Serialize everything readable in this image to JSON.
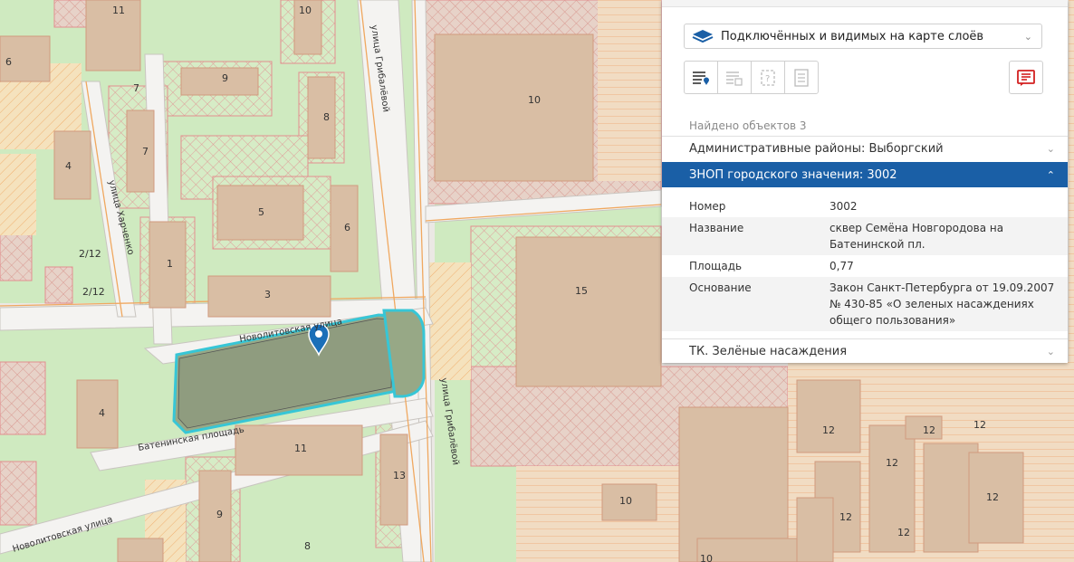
{
  "map": {
    "streets": {
      "gribalyova_north": "улица Грибалёвой",
      "gribalyova_south": "улица Грибалёвой",
      "kharchenko": "улица Харченко",
      "novolitovskaya_top": "Новолитовская улица",
      "novolitovskaya_bottom": "Новолитовская улица",
      "bateninskaya": "Батенинская площадь"
    },
    "house_numbers": {
      "h11a": "11",
      "h10a": "10",
      "h6a": "6",
      "h9a": "9",
      "h7a": "7",
      "h8a": "8",
      "h7b": "7",
      "h10big": "10",
      "h4a": "4",
      "h5": "5",
      "h6b": "6",
      "h2_12a": "2/12",
      "h1": "1",
      "h2_12b": "2/12",
      "h3": "3",
      "h15": "15",
      "h4b": "4",
      "h11b": "11",
      "h13": "13",
      "h12a": "12",
      "h12b": "12",
      "h12c": "12",
      "h12d": "12",
      "h12e": "12",
      "h12f": "12",
      "h12g": "12",
      "h10c": "10",
      "h9b": "9",
      "h8b": "8",
      "h10d": "10"
    },
    "marker_icon": "map-pin-icon"
  },
  "panel": {
    "layer_select": {
      "label": "Подключённых и видимых на карте слоёв",
      "icon": "layers-icon",
      "chevron": "chevron-down-icon"
    },
    "toolbar": [
      {
        "name": "list-view-button",
        "icon": "list-pin-icon"
      },
      {
        "name": "table-view-button",
        "icon": "list-grid-icon"
      },
      {
        "name": "unknown-object-button",
        "icon": "question-frame-icon"
      },
      {
        "name": "document-button",
        "icon": "document-lines-icon"
      }
    ],
    "report_button": {
      "icon": "report-icon",
      "color": "#d32020"
    },
    "found_count": "Найдено объектов 3",
    "sections": [
      {
        "title": "Административные районы: Выборгский",
        "expanded": false
      },
      {
        "title": "ЗНОП городского значения: 3002",
        "expanded": true
      },
      {
        "title": "ТК. Зелёные насаждения",
        "expanded": false
      }
    ],
    "attributes": [
      {
        "key": "Номер",
        "value": "3002"
      },
      {
        "key": "Название",
        "value": "сквер Семёна Новгородова на Батенинской пл."
      },
      {
        "key": "Площадь",
        "value": "0,77"
      },
      {
        "key": "Основание",
        "value": "Закон Санкт-Петербурга от 19.09.2007 № 430-85 «О зеленых насаждениях общего пользования»"
      }
    ],
    "accent_color": "#1a5fa6"
  }
}
